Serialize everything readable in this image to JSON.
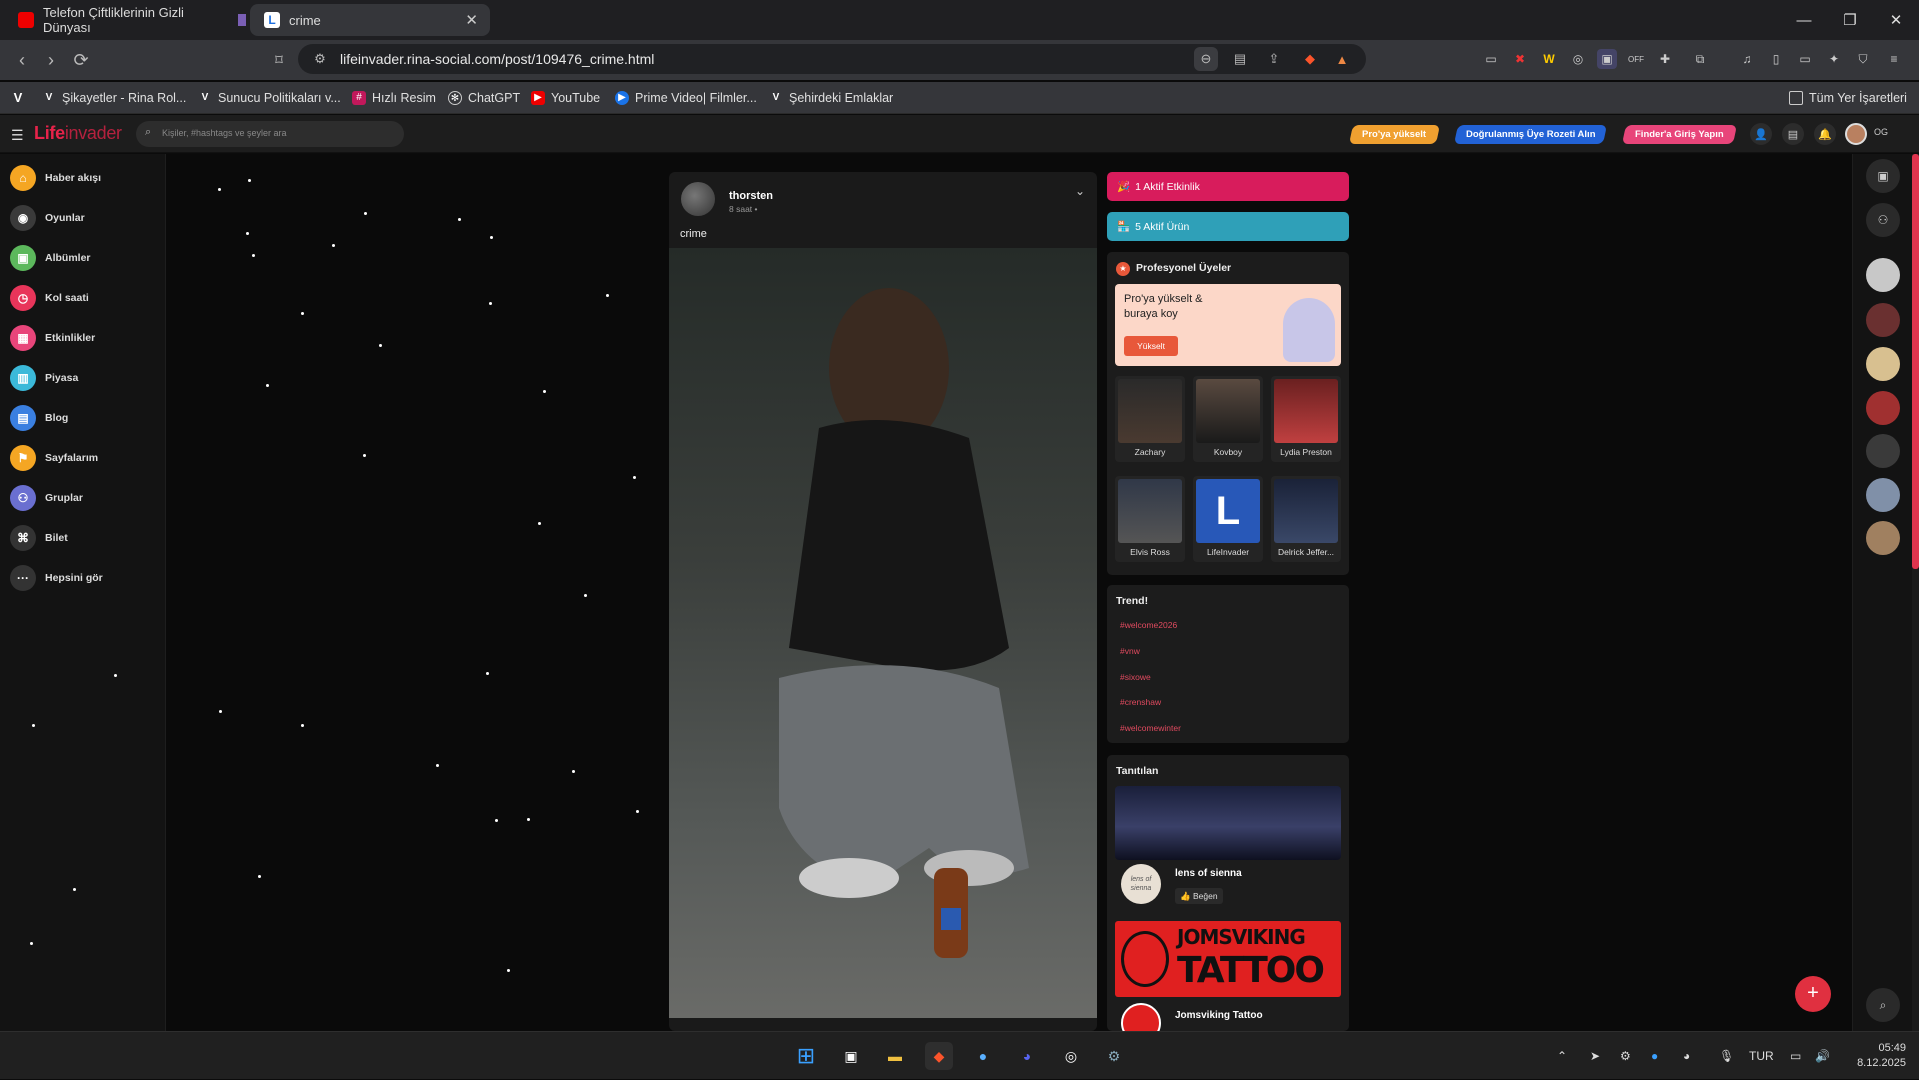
{
  "browser": {
    "tabs": [
      {
        "title": "Telefon Çiftliklerinin Gizli Dünyası",
        "active": false
      },
      {
        "title": "crime",
        "active": true
      }
    ],
    "url": "lifeinvader.rina-social.com/post/109476_crime.html",
    "bookmarks": [
      "Şikayetler - Rina Rol...",
      "Sunucu Politikaları v...",
      "Hızlı Resim",
      "ChatGPT",
      "YouTube",
      "Prime Video| Filmler...",
      "Şehirdeki Emlaklar"
    ],
    "all_bookmarks_label": "Tüm Yer İşaretleri"
  },
  "site": {
    "logo_main": "Life",
    "logo_sub": "invader",
    "search_placeholder": "Kişiler, #hashtags ve şeyler ara",
    "header_buttons": [
      "Pro'ya yükselt",
      "Doğrulanmış Üye Rozeti Alın",
      "Finder'a Giriş Yapın"
    ],
    "header_user_initials": "OG"
  },
  "left_nav": [
    "Haber akışı",
    "Oyunlar",
    "Albümler",
    "Kol saati",
    "Etkinlikler",
    "Piyasa",
    "Blog",
    "Sayfalarım",
    "Gruplar",
    "Bilet",
    "Hepsini gör"
  ],
  "post": {
    "author": "thorsten",
    "time": "8 saat",
    "text": "crime"
  },
  "right_column": {
    "active_events": "1 Aktif Etkinlik",
    "active_products": "5 Aktif Ürün",
    "pro_members_title": "Profesyonel Üyeler",
    "pro_promo_text": "Pro'ya yükselt & buraya koy",
    "pro_promo_button": "Yükselt",
    "members": [
      "Zachary",
      "Kovboy",
      "Lydia Preston",
      "Elvis Ross",
      "LifeInvader",
      "Delrick Jeffer..."
    ],
    "trend_title": "Trend!",
    "trends": [
      "#welcome2026",
      "#vnw",
      "#sixowe",
      "#crenshaw",
      "#welcomewinter"
    ],
    "promoted_title": "Tanıtılan",
    "promoted": [
      {
        "name": "lens of sienna",
        "like_label": "Beğen",
        "logo_text": "lens of sienna"
      },
      {
        "name": "Jomsviking Tattoo",
        "banner_line1": "JOMSVIKING",
        "banner_line2": "TATTOO"
      }
    ]
  },
  "taskbar": {
    "lang": "TUR",
    "time": "05:49",
    "date": "8.12.2025"
  }
}
